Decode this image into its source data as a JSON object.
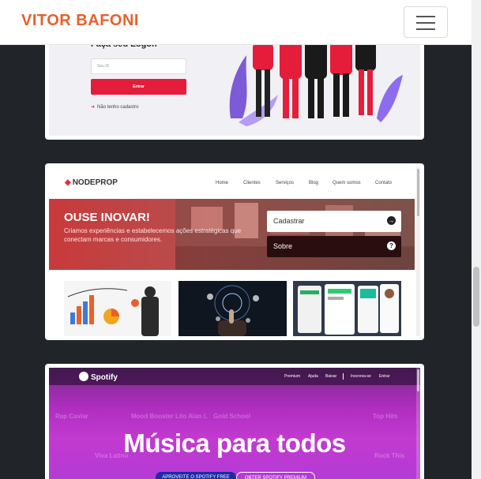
{
  "navbar": {
    "brand": "VITOR BAFONI",
    "menu_icon": "hamburger-icon"
  },
  "projects": {
    "login": {
      "heading": "Faça seu Logon",
      "input_placeholder": "Seu ID",
      "button_label": "Entrar",
      "signup_link": "Não tenho cadastro"
    },
    "nodeprop": {
      "logo": "NODEPROP",
      "nav": [
        "Home",
        "Clientes",
        "Serviços",
        "Blog",
        "Quem somos",
        "Contato"
      ],
      "hero_title": "OUSE INOVAR!",
      "hero_subtitle": "Criamos experiências e estabelecemos ações estratégicas que conectam marcas e consumidores.",
      "btn_cadastrar": "Cadastrar",
      "btn_sobre": "Sobre",
      "colors": {
        "accent": "#e02e3c",
        "hero": "#c83a3c"
      }
    },
    "spotify": {
      "logo": "Spotify",
      "nav": [
        "Premium",
        "Ajuda",
        "Baixar",
        "Inscreva-se",
        "Entrar"
      ],
      "headline": "Música para todos",
      "btn_free": "APROVEITE O SPOTIFY FREE",
      "btn_premium": "OBTER SPOTIFY PREMIUM",
      "background_labels": [
        "Rap Caviar",
        "Mood Booster",
        "Lilo Alan L",
        "Gold School",
        "Top Hits",
        "Viva Latino",
        "Rock This"
      ]
    }
  }
}
